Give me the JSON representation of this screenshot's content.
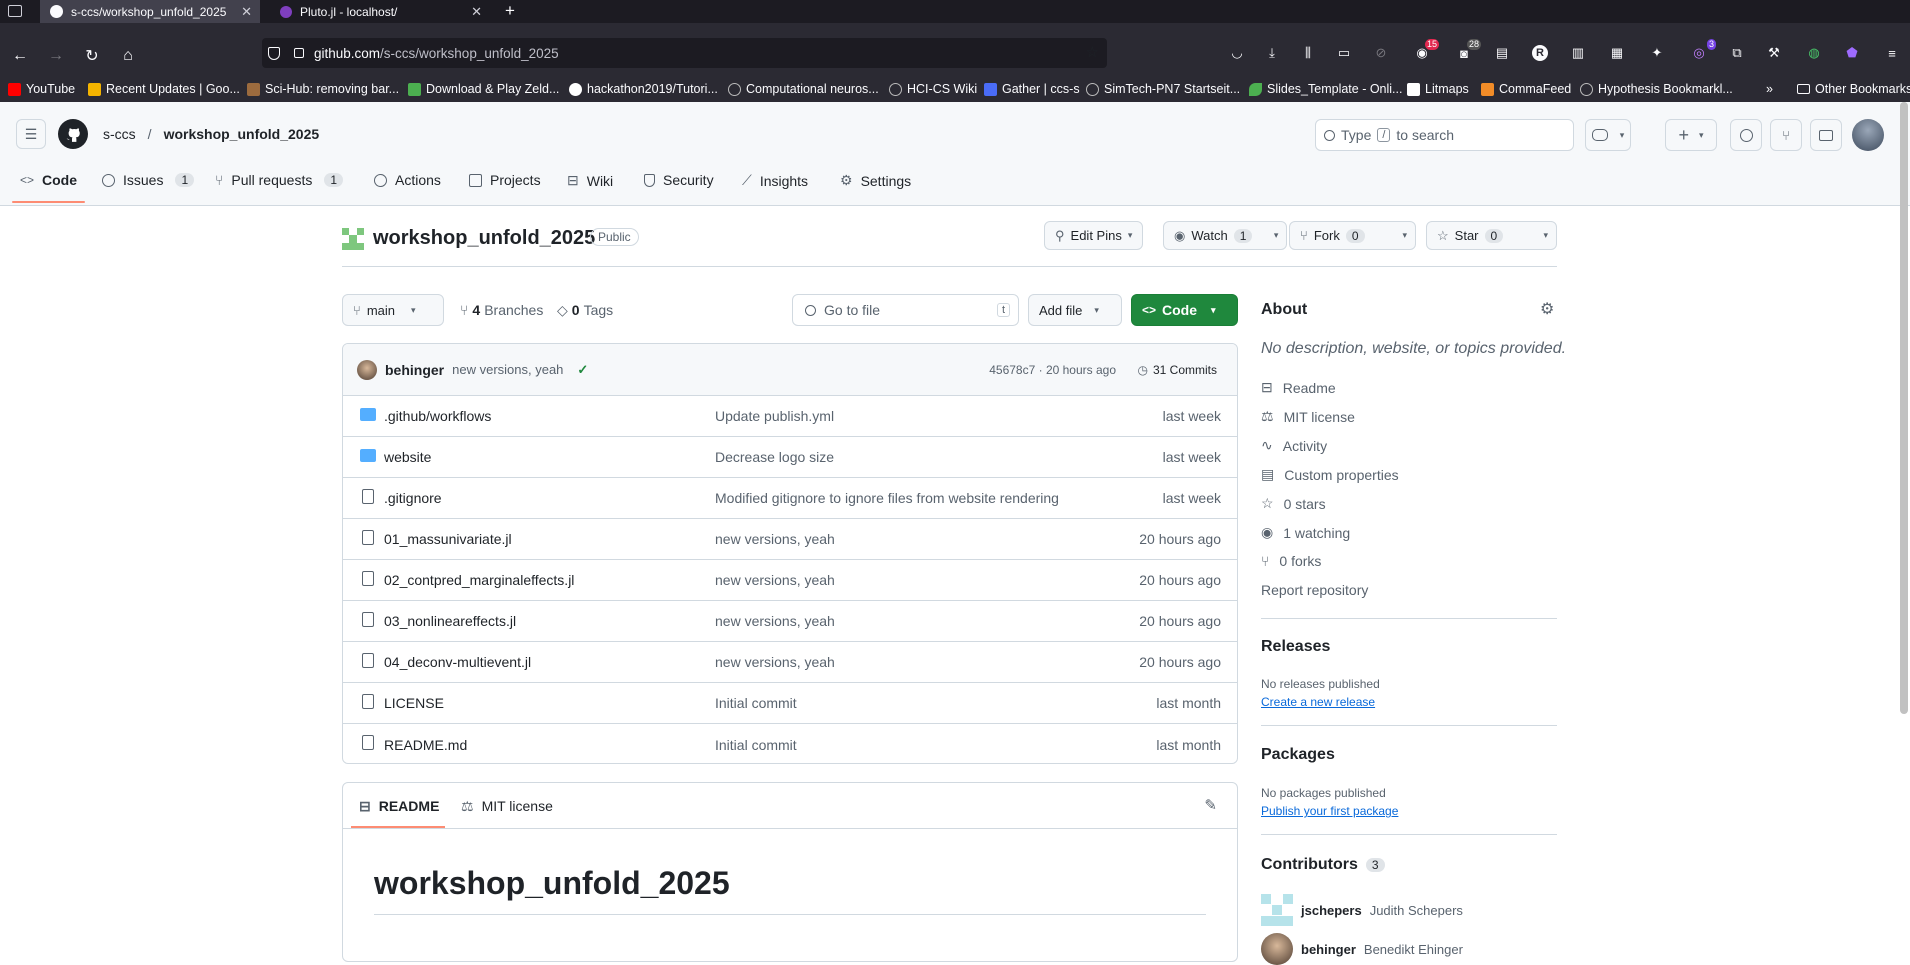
{
  "browser": {
    "tabs": [
      {
        "title": "s-ccs/workshop_unfold_2025"
      },
      {
        "title": "Pluto.jl - localhost/"
      }
    ],
    "url": {
      "domain": "github.com",
      "path": "/s-ccs/workshop_unfold_2025"
    },
    "ext_badges": {
      "a": "15",
      "b": "28",
      "c": "3"
    },
    "bookmarks": [
      {
        "label": "YouTube",
        "color": "#ff0000"
      },
      {
        "label": "Recent Updates | Goo...",
        "color": "#f4b400"
      },
      {
        "label": "Sci-Hub: removing bar...",
        "color": "#9c6b3e"
      },
      {
        "label": "Download & Play Zeld...",
        "color": "#4caf50"
      },
      {
        "label": "hackathon2019/Tutori...",
        "color": "#ffffff"
      },
      {
        "label": "Computational neuros...",
        "color": "#bbbbbb"
      },
      {
        "label": "HCI-CS Wiki",
        "color": "#bbbbbb"
      },
      {
        "label": "Gather | ccs-s",
        "color": "#4a6cf7"
      },
      {
        "label": "SimTech-PN7 Startseit...",
        "color": "#bbbbbb"
      },
      {
        "label": "Slides_Template - Onli...",
        "color": "#4caf50"
      },
      {
        "label": "Litmaps",
        "color": "#ffffff"
      },
      {
        "label": "CommaFeed",
        "color": "#f28c28"
      },
      {
        "label": "Hypothesis Bookmarkl...",
        "color": "#bbbbbb"
      }
    ],
    "other_bookmarks": "Other Bookmarks"
  },
  "header": {
    "owner": "s-ccs",
    "separator": "/",
    "repo": "workshop_unfold_2025",
    "search_placeholder_a": "Type",
    "search_key": "/",
    "search_placeholder_b": "to search",
    "plus": "+"
  },
  "repo_nav": [
    {
      "label": "Code",
      "count": ""
    },
    {
      "label": "Issues",
      "count": "1"
    },
    {
      "label": "Pull requests",
      "count": "1"
    },
    {
      "label": "Actions",
      "count": ""
    },
    {
      "label": "Projects",
      "count": ""
    },
    {
      "label": "Wiki",
      "count": ""
    },
    {
      "label": "Security",
      "count": ""
    },
    {
      "label": "Insights",
      "count": ""
    },
    {
      "label": "Settings",
      "count": ""
    }
  ],
  "repo": {
    "title": "workshop_unfold_2025",
    "visibility": "Public",
    "edit_pins": "Edit Pins",
    "watch": "Watch",
    "watch_count": "1",
    "fork": "Fork",
    "fork_count": "0",
    "star": "Star",
    "star_count": "0"
  },
  "branch_bar": {
    "branch": "main",
    "branches_count": "4",
    "branches_label": "Branches",
    "tags_count": "0",
    "tags_label": "Tags",
    "goto_placeholder": "Go to file",
    "goto_key": "t",
    "add_file": "Add file",
    "code": "Code"
  },
  "commit": {
    "author": "behinger",
    "message": "new versions, yeah",
    "meta": "45678c7 · 20 hours ago",
    "commits": "31 Commits"
  },
  "files": [
    {
      "name": ".github/workflows",
      "type": "dir",
      "message": "Update publish.yml",
      "date": "last week"
    },
    {
      "name": "website",
      "type": "dir",
      "message": "Decrease logo size",
      "date": "last week"
    },
    {
      "name": ".gitignore",
      "type": "file",
      "message": "Modified gitignore to ignore files from website rendering",
      "date": "last week"
    },
    {
      "name": "01_massunivariate.jl",
      "type": "file",
      "message": "new versions, yeah",
      "date": "20 hours ago"
    },
    {
      "name": "02_contpred_marginaleffects.jl",
      "type": "file",
      "message": "new versions, yeah",
      "date": "20 hours ago"
    },
    {
      "name": "03_nonlineareffects.jl",
      "type": "file",
      "message": "new versions, yeah",
      "date": "20 hours ago"
    },
    {
      "name": "04_deconv-multievent.jl",
      "type": "file",
      "message": "new versions, yeah",
      "date": "20 hours ago"
    },
    {
      "name": "LICENSE",
      "type": "file",
      "message": "Initial commit",
      "date": "last month"
    },
    {
      "name": "README.md",
      "type": "file",
      "message": "Initial commit",
      "date": "last month"
    }
  ],
  "readme": {
    "tab_readme": "README",
    "tab_license": "MIT license",
    "heading": "workshop_unfold_2025"
  },
  "about": {
    "title": "About",
    "description": "No description, website, or topics provided.",
    "items": [
      "Readme",
      "MIT license",
      "Activity",
      "Custom properties",
      "0 stars",
      "1 watching",
      "0 forks"
    ],
    "report": "Report repository"
  },
  "releases": {
    "title": "Releases",
    "text": "No releases published",
    "link": "Create a new release"
  },
  "packages": {
    "title": "Packages",
    "text": "No packages published",
    "link": "Publish your first package"
  },
  "contributors": {
    "title": "Contributors",
    "count": "3",
    "people": [
      {
        "login": "jschepers",
        "name": "Judith Schepers"
      },
      {
        "login": "behinger",
        "name": "Benedikt Ehinger"
      }
    ]
  },
  "colors": {
    "accent_green": "#1f883d",
    "link": "#0969da",
    "folder": "#54aeff",
    "tab_underline": "#fd8c73"
  }
}
